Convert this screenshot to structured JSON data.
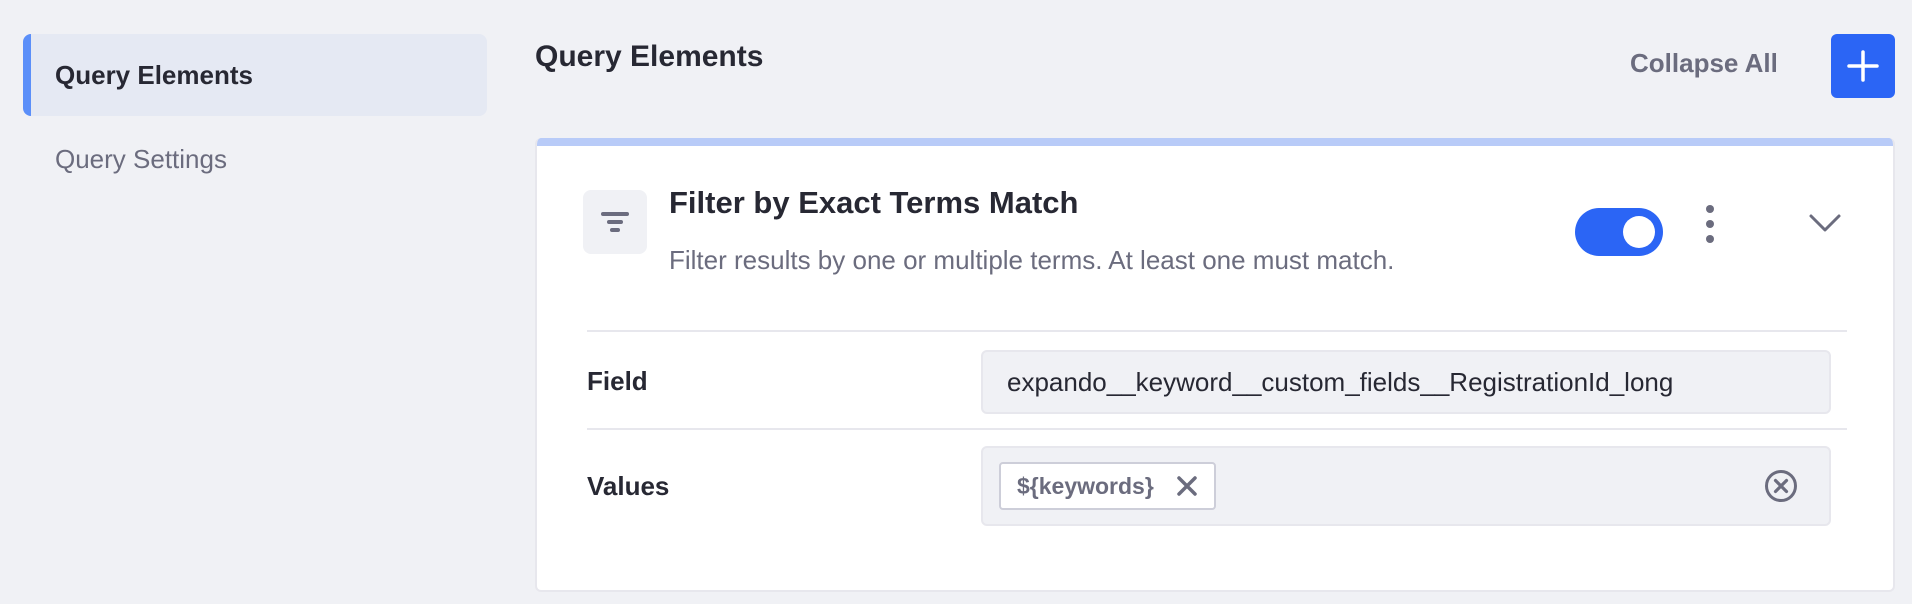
{
  "sidebar": {
    "items": [
      {
        "label": "Query Elements",
        "active": true
      },
      {
        "label": "Query Settings",
        "active": false
      }
    ]
  },
  "header": {
    "title": "Query Elements",
    "collapse_all_label": "Collapse All",
    "add_button_icon": "plus-icon"
  },
  "element_card": {
    "icon": "filter-icon",
    "title": "Filter by Exact Terms Match",
    "description": "Filter results by one or multiple terms. At least one must match.",
    "enabled": true,
    "menu_icon": "kebab-menu-icon",
    "expand_icon": "chevron-down-icon",
    "fields": {
      "field_label": "Field",
      "field_value": "expando__keyword__custom_fields__RegistrationId_long",
      "values_label": "Values",
      "values": [
        "${keywords}"
      ]
    }
  },
  "colors": {
    "accent": "#2b65f5",
    "active_nav_marker": "#5b8ff9",
    "card_top_bar": "#b8cbf8",
    "background": "#f0f1f5",
    "secondary_text": "#6b6c7e",
    "primary_text": "#272833"
  }
}
